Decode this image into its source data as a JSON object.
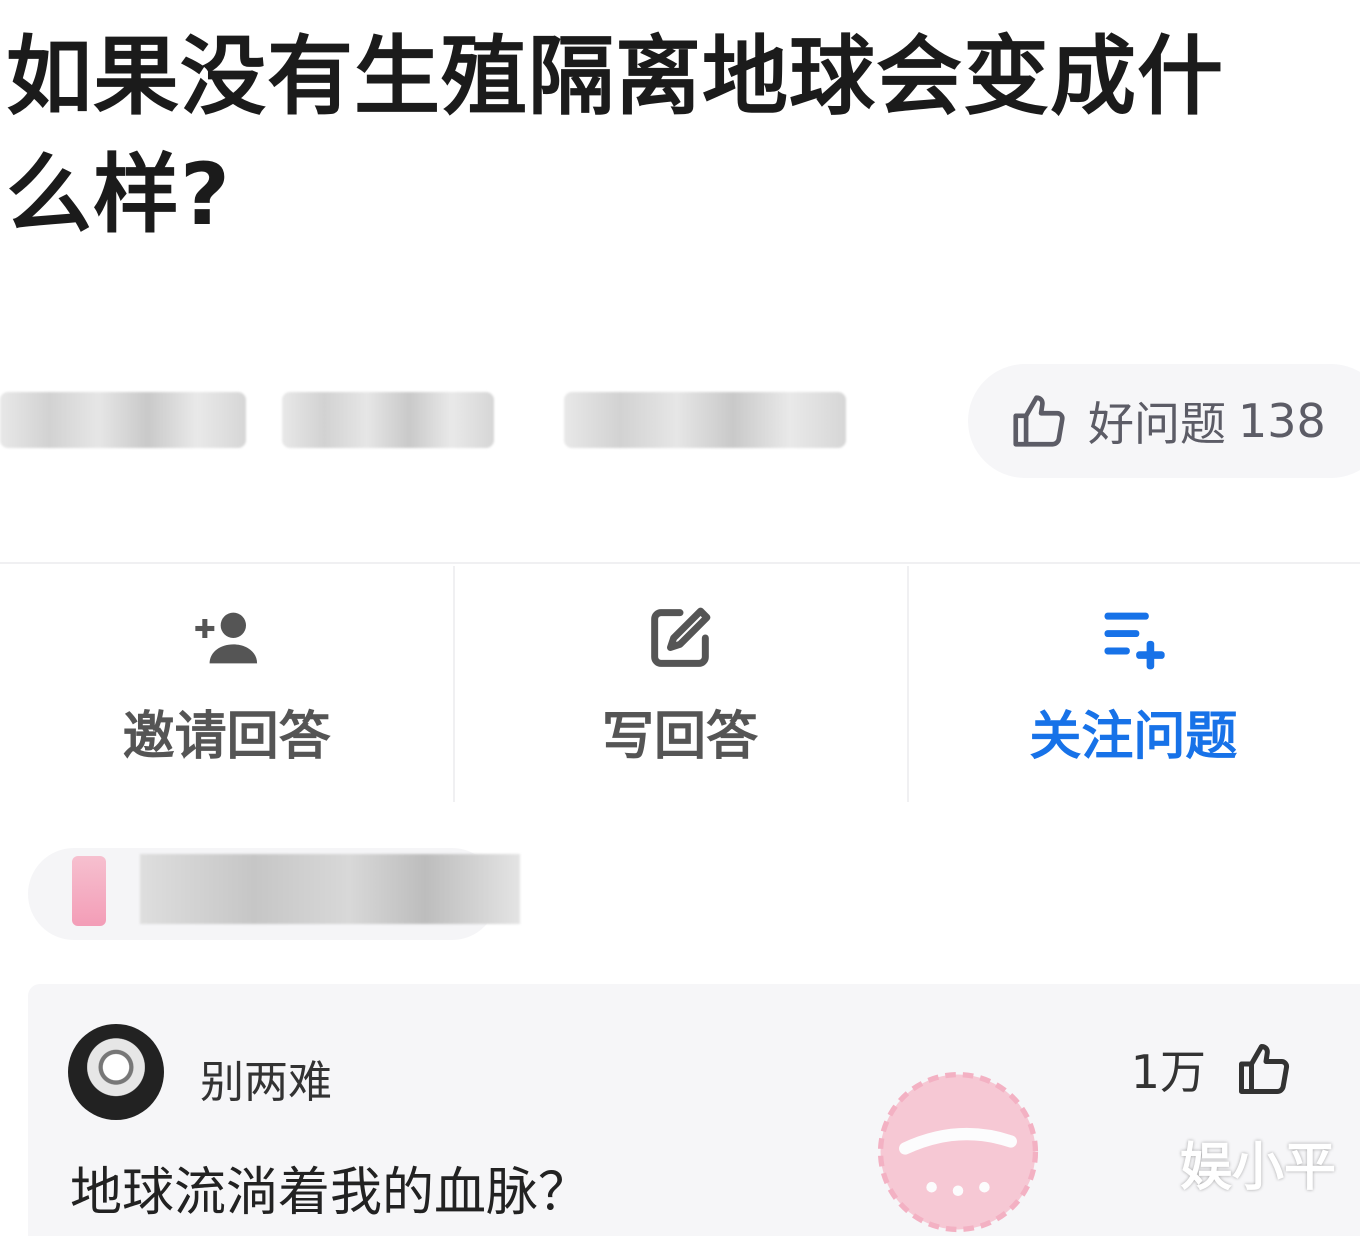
{
  "question": {
    "title": "如果没有生殖隔离地球会变成什么样?",
    "good_question_label": "好问题",
    "good_question_count": "138"
  },
  "actions": [
    {
      "label": "邀请回答",
      "icon": "add-person-icon"
    },
    {
      "label": "写回答",
      "icon": "edit-icon"
    },
    {
      "label": "关注问题",
      "icon": "follow-list-icon"
    }
  ],
  "answer": {
    "author": "别两难",
    "likes": "1万",
    "text": "地球流淌着我的血脉？",
    "badge_icon": "god-review-stamp-icon"
  },
  "watermark": "娱小平",
  "colors": {
    "accent": "#1772e8",
    "pink": "#f39db7"
  }
}
